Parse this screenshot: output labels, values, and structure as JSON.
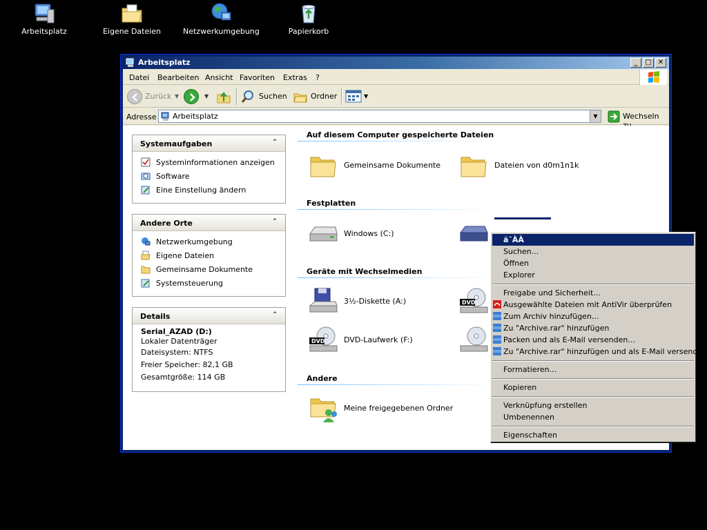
{
  "desktop": {
    "icons": [
      {
        "label": "Arbeitsplatz"
      },
      {
        "label": "Eigene Dateien"
      },
      {
        "label": "Netzwerkumgebung"
      },
      {
        "label": "Papierkorb"
      }
    ]
  },
  "window": {
    "title": "Arbeitsplatz",
    "controls": {
      "minimize": "_",
      "maximize": "□",
      "close": "✕"
    },
    "menu": [
      "Datei",
      "Bearbeiten",
      "Ansicht",
      "Favoriten",
      "Extras",
      "?"
    ],
    "toolbar": {
      "back": "Zurück",
      "search": "Suchen",
      "folders": "Ordner"
    },
    "address": {
      "label": "Adresse",
      "value": "Arbeitsplatz",
      "go": "Wechseln zu"
    }
  },
  "panes": {
    "system": {
      "title": "Systemaufgaben",
      "items": [
        "Systeminformationen anzeigen",
        "Software",
        "Eine Einstellung ändern"
      ]
    },
    "other": {
      "title": "Andere Orte",
      "items": [
        "Netzwerkumgebung",
        "Eigene Dateien",
        "Gemeinsame Dokumente",
        "Systemsteuerung"
      ]
    },
    "details": {
      "title": "Details",
      "name": "Serial_AZAD (D:)",
      "type": "Lokaler Datenträger",
      "filesystem": "Dateisystem: NTFS",
      "free": "Freier Speicher: 82,1 GB",
      "total": "Gesamtgröße: 114 GB"
    }
  },
  "sections": {
    "stored": {
      "title": "Auf diesem Computer gespeicherte Dateien",
      "items": [
        "Gemeinsame Dokumente",
        "Dateien von d0m1n1k"
      ]
    },
    "drives": {
      "title": "Festplatten",
      "items": [
        "Windows (C:)"
      ]
    },
    "removable": {
      "title": "Geräte mit Wechselmedien",
      "items": [
        "3½-Diskette (A:)",
        "DVD-Laufwerk (F:)"
      ]
    },
    "other": {
      "title": "Andere",
      "items": [
        "Meine freigegebenen Ordner"
      ]
    }
  },
  "context_menu": {
    "items": [
      "ã¯ÀÀ",
      "Suchen...",
      "Öffnen",
      "Explorer",
      "Freigabe und Sicherheit...",
      "Ausgewählte Dateien mit AntiVir überprüfen",
      "Zum Archiv hinzufügen...",
      "Zu \"Archive.rar\" hinzufügen",
      "Packen und als E-Mail versenden...",
      "Zu \"Archive.rar\" hinzufügen und als E-Mail versenden",
      "Formatieren...",
      "Kopieren",
      "Verknüpfung erstellen",
      "Umbenennen",
      "Eigenschaften"
    ]
  },
  "colors": {
    "titlebar": "#0a246a",
    "selection": "#0a246a",
    "pane_bg": "#ffffff",
    "window_bg": "#ece9d8"
  }
}
